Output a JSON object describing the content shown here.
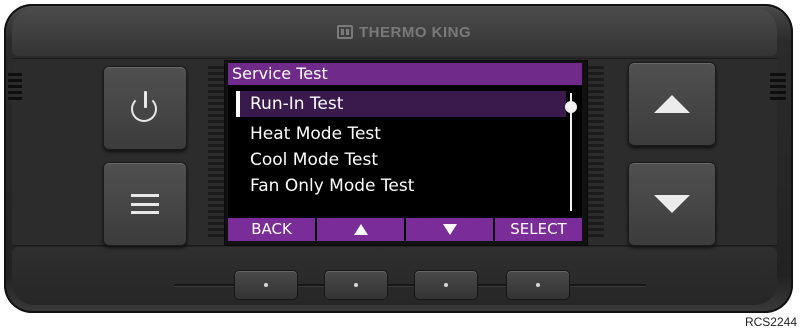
{
  "brand": {
    "name": "THERMO KING",
    "logo_icon": "thermo-king-logo-icon"
  },
  "screen": {
    "title": "Service Test",
    "items": [
      {
        "label": "Run-In Test",
        "selected": true
      },
      {
        "label": "Heat Mode Test",
        "selected": false
      },
      {
        "label": "Cool Mode Test",
        "selected": false
      },
      {
        "label": "Fan Only Mode Test",
        "selected": false
      }
    ],
    "softkeys": {
      "back": "BACK",
      "up_icon": "up-triangle-icon",
      "down_icon": "down-triangle-icon",
      "select": "SELECT"
    },
    "colors": {
      "accent": "#7a2c98",
      "title_bar": "#6f2a8a",
      "background": "#000000"
    }
  },
  "hardware_buttons": {
    "power_icon": "power-icon",
    "menu_icon": "menu-icon",
    "up_icon": "up-arrow-icon",
    "down_icon": "down-arrow-icon"
  },
  "figure_id": "RCS2244"
}
